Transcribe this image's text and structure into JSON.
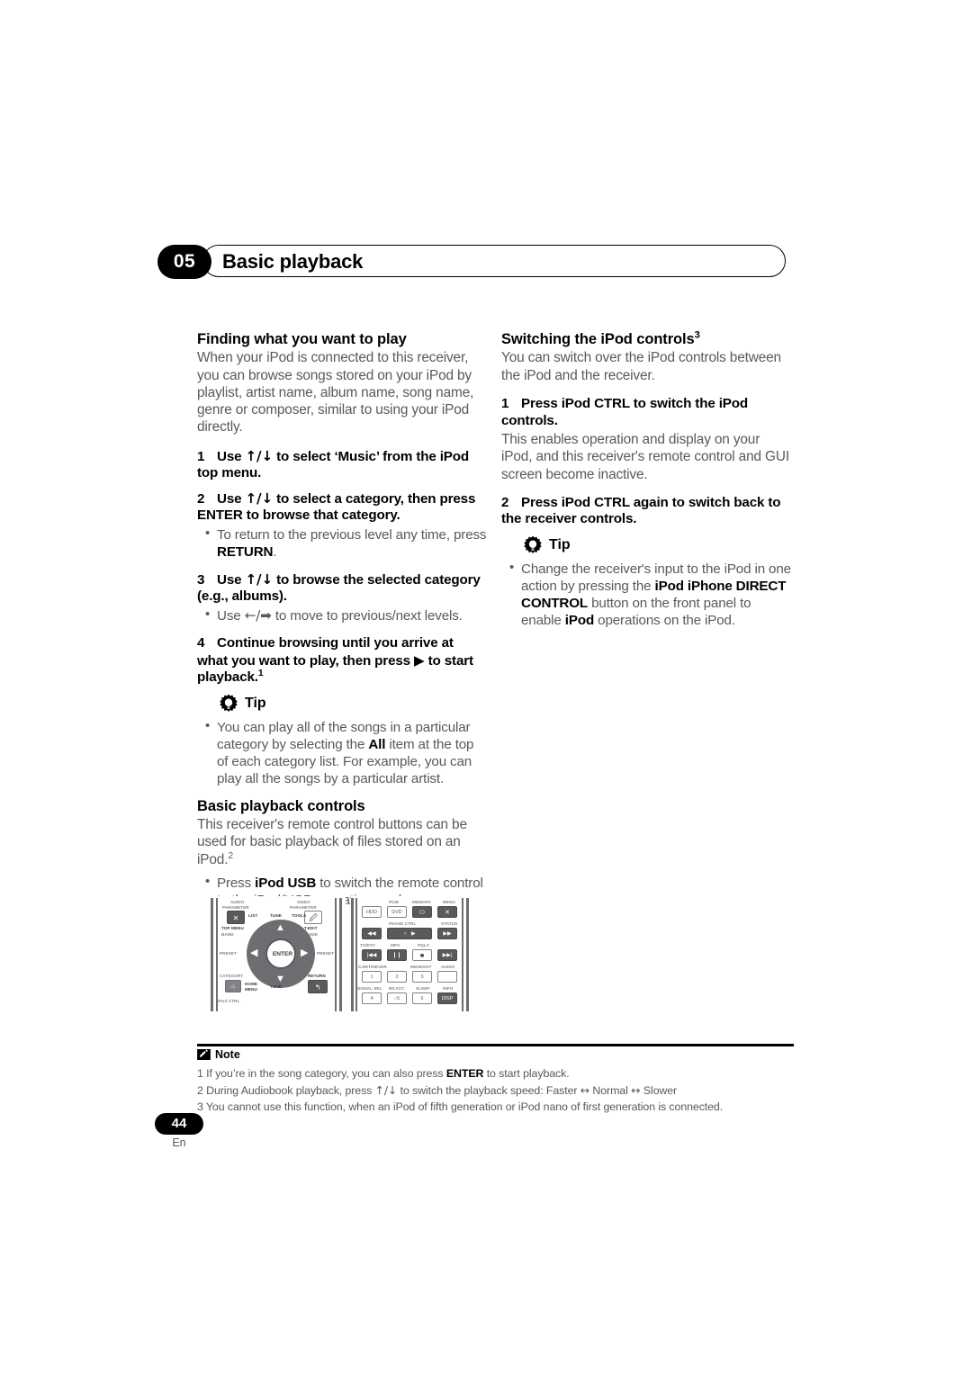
{
  "header": {
    "chapter_number": "05",
    "chapter_title": "Basic playback"
  },
  "left_column": {
    "section1_title": "Finding what you want to play",
    "section1_body": "When your iPod is connected to this receiver, you can browse songs stored on your iPod by playlist, artist name, album name, song name, genre or composer, similar to using your iPod directly.",
    "steps": [
      {
        "num": "1",
        "text": "Use ↑/↓ to select ‘Music’ from the iPod top menu."
      },
      {
        "num": "2",
        "text": "Use ↑/↓ to select a category, then press ENTER to browse that category."
      },
      {
        "num": "3",
        "text": "Use ↑/↓ to browse the selected category (e.g., albums)."
      },
      {
        "num": "4",
        "text": "Continue browsing until you arrive at what you want to play, then press ▶ to start playback.1"
      }
    ],
    "bullet_step2": "To return to the previous level any time, press RETURN.",
    "bullet_step3": "Use ←/➡ to move to previous/next levels.",
    "tip_label": "Tip",
    "tip_bullet": "You can play all of the songs in a particular category by selecting the All item at the top of each category list. For example, you can play all the songs by a particular artist.",
    "section2_title": "Basic playback controls",
    "section2_body": "This receiver's remote control buttons can be used for basic playback of files stored on an iPod.2",
    "section2_bullet": "Press iPod USB to switch the remote control to the iPod/USB operation mode."
  },
  "right_column": {
    "section1_title": "Switching the iPod controls3",
    "section1_body": "You can switch over the iPod controls between the iPod and the receiver.",
    "steps": [
      {
        "num": "1",
        "text": "Press iPod CTRL to switch the iPod controls."
      },
      {
        "num": "2",
        "text": "Press iPod CTRL again to switch back to the receiver controls."
      }
    ],
    "step1_body": "This enables operation and display on your iPod, and this receiver's remote control and GUI screen become inactive.",
    "tip_label": "Tip",
    "tip_bullet": "Change the receiver's input to the iPod in one action by pressing the iPod iPhone DIRECT CONTROL button on the front panel to enable iPod operations on the iPod."
  },
  "remote_left": {
    "labels": {
      "audio_parameter": "AUDIO PARAMETER",
      "video_parameter": "VIDEO PARAMETER",
      "list": "LIST",
      "tune_top": "TUNE",
      "tools": "TOOLS",
      "top_menu": "TOP MENU",
      "band": "BAND",
      "t_edit": "T.EDIT",
      "guide": "GUIDE",
      "preset_left": "PRESET",
      "preset_right": "PRESET",
      "enter": "ENTER",
      "category": "CATEGORY",
      "home_menu": "HOME MENU",
      "tune_bottom": "TUNE",
      "return": "RETURN",
      "ipod_ctrl": "iPod CTRL"
    }
  },
  "remote_right": {
    "labels": {
      "pgm": "PGM",
      "memory": "MEMORY",
      "menu": "MENU",
      "hdd": "HDD",
      "dvd": "DVD",
      "phase_ctrl": "PHASE CTRL",
      "status": "STATUS",
      "tv_dtv": "TV/DTV",
      "mpx": "MPX",
      "pqls": "PQLS",
      "s_retriever": "S.RETRIEVER",
      "midnight": "MIDNIGHT",
      "audio": "AUDIO",
      "signal_sel": "SIGNAL SEL",
      "mcacc": "MCACC",
      "sleep": "SLEEP",
      "info": "INFO",
      "disp": "DISP",
      "key1": "1",
      "key2": "2",
      "key3": "3",
      "key4": "4",
      "key5": "5",
      "key6": "6"
    }
  },
  "notes": {
    "label": "Note",
    "items": [
      "1 If you’re in the song category, you can also press ENTER to start playback.",
      "2 During Audiobook playback, press ↑/↓ to switch the playback speed: Faster ↔ Normal ↔ Slower",
      "3 You cannot use this function, when an iPod of fifth generation or iPod nano of first generation is connected."
    ]
  },
  "footer": {
    "page_number": "44",
    "language": "En"
  },
  "colors": {
    "text_body": "#58595b",
    "text_bold": "#000000",
    "accent": "#000000"
  }
}
